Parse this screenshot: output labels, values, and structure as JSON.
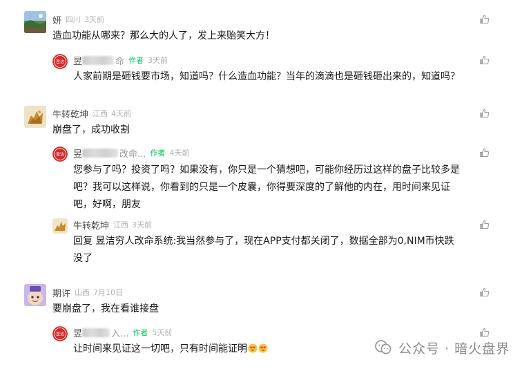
{
  "comments": [
    {
      "user": "妍",
      "location": "四川",
      "time": "3天前",
      "text": "造血功能从哪来？那么大的人了，发上来贻笑大方！",
      "reply": {
        "user_visible": "昱",
        "user_tail": "命",
        "author_tag": "作者",
        "time": "3天前",
        "text": "人家前期是砸钱要市场，知道吗？什么造血功能？当年的滴滴也是砸钱砸出来的，知道吗？"
      }
    },
    {
      "user": "牛转乾坤",
      "location": "江西",
      "time": "4天前",
      "text": "崩盘了，成功收割",
      "reply": {
        "user_visible": "昱",
        "user_tail": "改命...",
        "author_tag": "作者",
        "time": "4天前",
        "text_lines": [
          "您参与了吗？投资了吗？如果没有，你只是一个猜想吧，可能你经历过这样的盘子比较多是",
          "吧？我可以这样说，你看到的只是一个皮囊，你得要深度的了解他的内在，用时间来见证",
          "吧，好啊，朋友"
        ]
      },
      "reply2": {
        "user": "牛转乾坤",
        "location": "江西",
        "time": "3天前",
        "prefix": "回复 昱洁穷人改命系统:",
        "text_lines": [
          "我当然参与了，现在APP支付都关闭了，数据全部为0,NIM币快跌",
          "没了"
        ]
      }
    },
    {
      "user": "期许",
      "location": "山西",
      "time": "7月10日",
      "text": "要崩盘了，我在看谁接盘",
      "reply": {
        "user_visible": "昱",
        "user_tail": "入...",
        "author_tag": "作者",
        "time": "5天前",
        "text": "让时间来见证这一切吧，只有时间能证明"
      }
    }
  ],
  "watermark": {
    "text": "公众号 · 暗火盘界"
  },
  "colors": {
    "author_green": "#07c160",
    "meta_gray": "#b2b2b2",
    "avatar_red": "#d62a2a"
  }
}
